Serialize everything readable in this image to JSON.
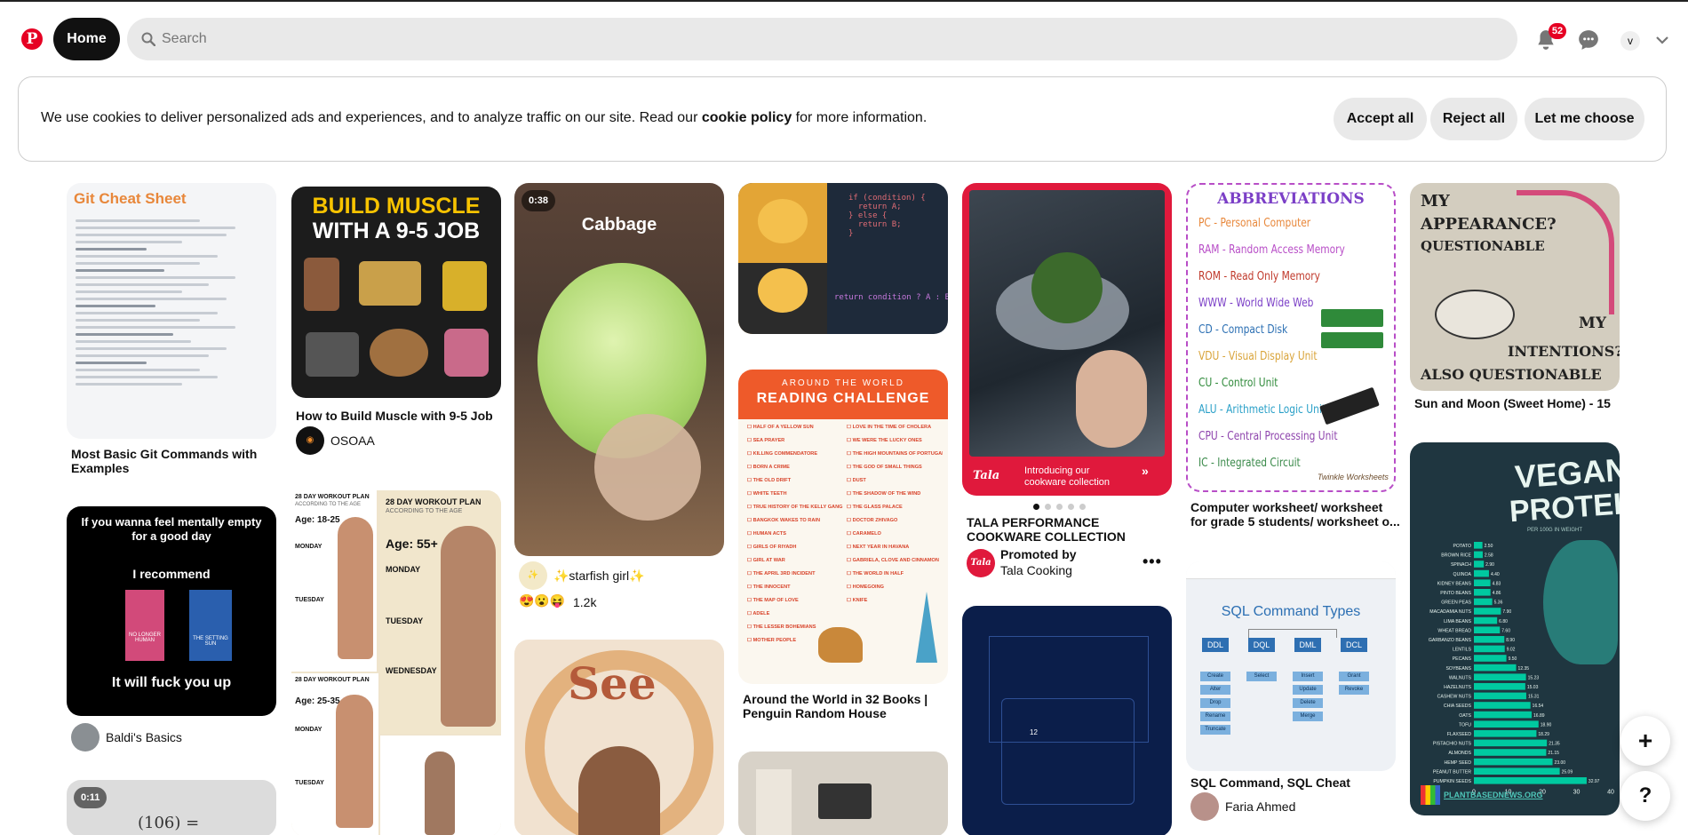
{
  "header": {
    "home_label": "Home",
    "search_placeholder": "Search",
    "notifications_count": "52",
    "avatar_initial": "v",
    "logo_glyph": "P"
  },
  "cookie_banner": {
    "text_before": "We use cookies to deliver personalized ads and experiences, and to analyze traffic on our site. Read our ",
    "link": "cookie policy",
    "text_after": " for more information.",
    "accept": "Accept all",
    "reject": "Reject all",
    "choose": "Let me choose"
  },
  "pins": {
    "git": {
      "heading": "Git Cheat Sheet",
      "title": "Most Basic Git Commands with Examples"
    },
    "muscle": {
      "line1": "BUILD MUSCLE",
      "line2": "WITH A 9-5 JOB",
      "title": "How to Build Muscle with 9-5 Job",
      "user": "OSOAA"
    },
    "cabbage": {
      "duration": "0:38",
      "label": "Cabbage",
      "user": "✨starfish girl✨",
      "reactions": "😍😮😝",
      "reaction_count": "1.2k"
    },
    "code": {
      "top": "if (condition) {\n  return A;\n} else {\n  return B;\n}",
      "bottom": "return condition ? A : B;"
    },
    "tala": {
      "overlay": "Introducing our cookware collection",
      "brand": "Tala",
      "title": "TALA PERFORMANCE COOKWARE COLLECTION",
      "promoted": "Promoted by",
      "user": "Tala Cooking"
    },
    "abbr": {
      "heading": "ABBREVIATIONS",
      "items": [
        "PC - Personal Computer",
        "RAM - Random Access Memory",
        "ROM - Read Only Memory",
        "WWW - World Wide Web",
        "CD - Compact Disk",
        "VDU - Visual Display Unit",
        "CU - Control Unit",
        "ALU - Arithmetic Logic Unit",
        "CPU - Central Processing Unit",
        "IC - Integrated Circuit"
      ],
      "credit": "Twinkle Worksheets",
      "title": "Computer worksheet/ worksheet for grade 5 students/ worksheet o..."
    },
    "moon": {
      "l1": "MY",
      "l2": "APPEARANCE?",
      "l3": "QUESTIONABLE",
      "l4": "MY",
      "l5": "INTENTIONS?",
      "l6": "ALSO QUESTIONABLE",
      "title": "Sun and Moon (Sweet Home) - 15"
    },
    "meme": {
      "l1": "If you wanna feel mentally empty for a good day",
      "l2": "I recommend",
      "book1": "NO LONGER HUMAN",
      "book2": "THE SETTING SUN",
      "l3": "It will fuck you up",
      "user": "Baldi's Basics"
    },
    "workout": {
      "title": "28 DAY WORKOUT PLAN",
      "sub": "ACCORDING TO THE AGE",
      "age1": "Age: 18-25",
      "age2": "Age: 55+",
      "age3": "Age: 25-35",
      "days": [
        "MONDAY",
        "TUESDAY",
        "WEDNESDAY"
      ]
    },
    "reading": {
      "small": "AROUND THE WORLD",
      "heading": "READING CHALLENGE",
      "title": "Around the World in 32 Books | Penguin Random House",
      "books_left": [
        "HALF OF A YELLOW SUN",
        "SEA PRAYER",
        "KILLING COMMENDATORE",
        "BORN A CRIME",
        "THE OLD DRIFT",
        "WHITE TEETH",
        "TRUE HISTORY OF THE KELLY GANG",
        "BANGKOK WAKES TO RAIN",
        "HUMAN ACTS",
        "GIRLS OF RIYADH",
        "GIRL AT WAR",
        "THE APRIL 3RD INCIDENT",
        "THE INNOCENT",
        "THE MAP OF LOVE",
        "ADÈLE",
        "THE LESSER BOHEMIANS",
        "MOTHER PEOPLE"
      ],
      "books_right": [
        "LOVE IN THE TIME OF CHOLERA",
        "WE WERE THE LUCKY ONES",
        "THE HIGH MOUNTAINS OF PORTUGAL",
        "THE GOD OF SMALL THINGS",
        "DUST",
        "THE SHADOW OF THE WIND",
        "THE GLASS PALACE",
        "DOCTOR ZHIVAGO",
        "CARAMELO",
        "NEXT YEAR IN HAVANA",
        "GABRIELA, CLOVE AND CINNAMON",
        "THE WORLD IN HALF",
        "HOMEGOING",
        "KNIFE"
      ]
    },
    "sql": {
      "heading": "SQL Command Types",
      "types": [
        "DDL",
        "DQL",
        "DML",
        "DCL"
      ],
      "cmds": [
        [
          "Create",
          "Alter",
          "Drop",
          "Rename",
          "Truncate"
        ],
        [
          "Select"
        ],
        [
          "Insert",
          "Update",
          "Delete",
          "Merge"
        ],
        [
          "Grant",
          "Revoke"
        ]
      ],
      "title": "SQL Command, SQL Cheat Sheet,...",
      "user": "Faria Ahmed"
    },
    "vegan": {
      "h1": "VEGAN",
      "h2": "PROTEIN",
      "sub": "PER 100G IN WEIGHT",
      "footer": "PLANTBASEDNEWS.ORG"
    },
    "see": {
      "word": "See"
    },
    "math": {
      "duration": "0:11",
      "text": "(106) ="
    }
  },
  "chart_data": {
    "type": "bar",
    "title": "VEGAN PROTEIN",
    "subtitle": "PER 100G IN WEIGHT",
    "categories": [
      "POTATO",
      "BROWN RICE",
      "SPINACH",
      "QUINOA",
      "KIDNEY BEANS",
      "PINTO BEANS",
      "GREEN PEAS",
      "MACADAMIA NUTS",
      "LIMA BEANS",
      "WHEAT BREAD",
      "GARBANZO BEANS",
      "LENTILS",
      "PECANS",
      "SOYBEANS",
      "WALNUTS",
      "HAZELNUTS",
      "CASHEW NUTS",
      "CHIA SEEDS",
      "OATS",
      "TOFU",
      "FLAXSEED",
      "PISTACHIO NUTS",
      "ALMONDS",
      "HEMP SEED",
      "PEANUT BUTTER",
      "PUMPKIN SEEDS"
    ],
    "values": [
      2.5,
      2.58,
      2.9,
      4.4,
      4.83,
      4.86,
      5.36,
      7.9,
      6.8,
      7.6,
      8.9,
      9.02,
      9.5,
      12.35,
      15.23,
      15.03,
      15.31,
      16.54,
      16.89,
      18.9,
      18.29,
      21.35,
      21.15,
      23.0,
      25.09,
      32.97
    ],
    "ylim": [
      0,
      40
    ],
    "ticks": [
      "0",
      "10",
      "20",
      "30",
      "40"
    ],
    "colors": {
      "bar": "#00c9a0",
      "bg": "#1f3640"
    }
  },
  "buttons": {
    "create": "+",
    "help": "?"
  },
  "colors": {
    "brand": "#e60023"
  }
}
